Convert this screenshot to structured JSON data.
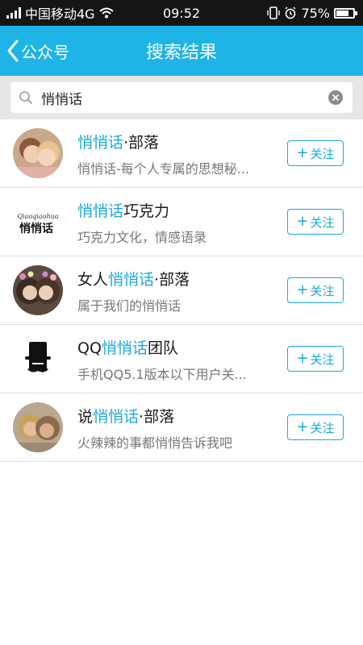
{
  "status_bar": {
    "carrier": "中国移动4G",
    "time": "09:52",
    "battery": "75%",
    "battery_level": 0.75
  },
  "header": {
    "back_label": "公众号",
    "title": "搜索结果"
  },
  "search": {
    "value": "悄悄话"
  },
  "results": [
    {
      "name_parts": [
        "悄悄话",
        "·部落",
        ""
      ],
      "description": "悄悄话-每个人专属的思想秘...",
      "action": "关注"
    },
    {
      "name_parts": [
        "悄悄话",
        "巧克力",
        ""
      ],
      "description": "巧克力文化，情感语录",
      "action": "关注"
    },
    {
      "name_parts": [
        "女人",
        "悄悄话",
        "·部落"
      ],
      "description": "属于我们的悄悄话",
      "action": "关注"
    },
    {
      "name_parts": [
        "QQ",
        "悄悄话",
        "团队"
      ],
      "description": "手机QQ5.1版本以下用户关...",
      "action": "关注"
    },
    {
      "name_parts": [
        "说",
        "悄悄话",
        "·部落"
      ],
      "description": "火辣辣的事都悄悄告诉我吧",
      "action": "关注"
    }
  ],
  "logo_text": "Qiaoqiaohua 悄悄话",
  "colors": {
    "accent": "#1fb4e6",
    "highlight": "#1ba8dd",
    "status_bar": "#151515"
  }
}
